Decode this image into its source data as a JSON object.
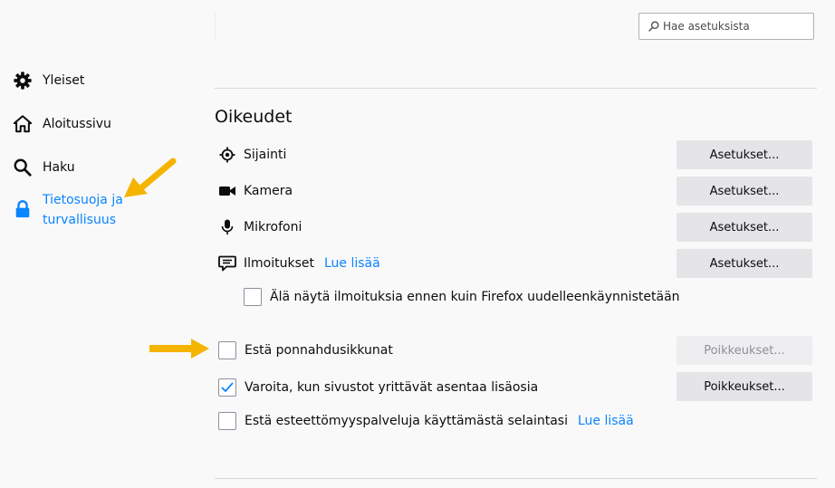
{
  "search": {
    "placeholder": "Hae asetuksista"
  },
  "sidebar": {
    "items": [
      {
        "label": "Yleiset",
        "icon": "gear-icon"
      },
      {
        "label": "Aloitussivu",
        "icon": "home-icon"
      },
      {
        "label": "Haku",
        "icon": "search-icon"
      },
      {
        "label_line1": "Tietosuoja ja",
        "label_line2": "turvallisuus",
        "icon": "lock-icon",
        "selected": true
      }
    ]
  },
  "permissions": {
    "title": "Oikeudet",
    "rows": [
      {
        "label": "Sijainti",
        "icon": "location-icon",
        "button": "Asetukset..."
      },
      {
        "label": "Kamera",
        "icon": "camera-icon",
        "button": "Asetukset..."
      },
      {
        "label": "Mikrofoni",
        "icon": "microphone-icon",
        "button": "Asetukset..."
      },
      {
        "label": "Ilmoitukset",
        "icon": "notification-icon",
        "link": "Lue lisää",
        "button": "Asetukset..."
      }
    ],
    "notification_pause": {
      "label": "Älä näytä ilmoituksia ennen kuin Firefox uudelleenkäynnistetään",
      "checked": false
    },
    "block_popups": {
      "label": "Estä ponnahdusikkunat",
      "checked": false,
      "button": "Poikkeukset...",
      "button_disabled": true
    },
    "warn_addons": {
      "label": "Varoita, kun sivustot yrittävät asentaa lisäosia",
      "checked": true,
      "button": "Poikkeukset..."
    },
    "block_accessibility": {
      "label": "Estä esteettömyyspalveluja käyttämästä selaintasi",
      "checked": false,
      "link": "Lue lisää"
    }
  },
  "colors": {
    "accent": "#0a84ff",
    "arrow": "#f5b400",
    "button_bg": "#e5e5e8",
    "page_bg": "#f9f9fa"
  }
}
